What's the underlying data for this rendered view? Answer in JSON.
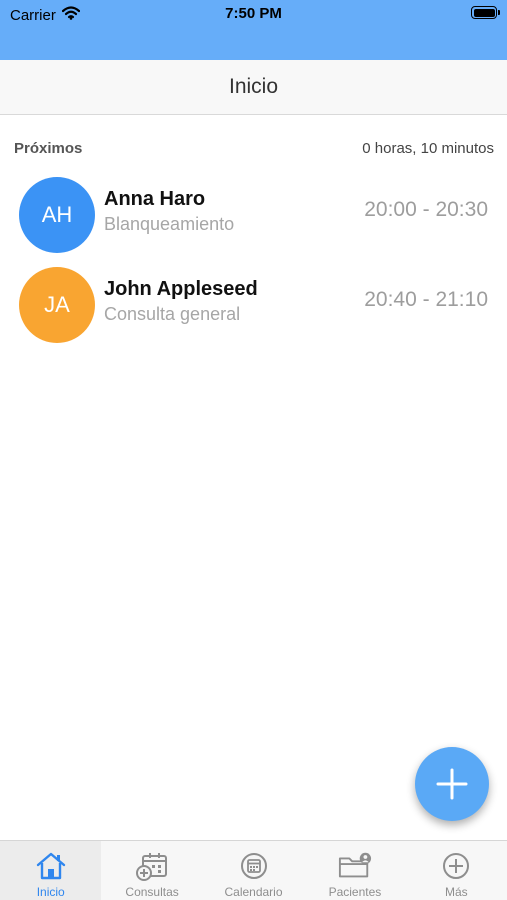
{
  "status_bar": {
    "carrier": "Carrier",
    "time": "7:50 PM"
  },
  "nav": {
    "title": "Inicio"
  },
  "section": {
    "title": "Próximos",
    "remaining": "0 horas, 10 minutos"
  },
  "appointments": [
    {
      "initials": "AH",
      "name": "Anna Haro",
      "treatment": "Blanqueamiento",
      "time": "20:00 - 20:30",
      "avatar_color": "#3b93f5"
    },
    {
      "initials": "JA",
      "name": "John Appleseed",
      "treatment": "Consulta general",
      "time": "20:40 - 21:10",
      "avatar_color": "#f9a531"
    }
  ],
  "tabs": [
    {
      "label": "Inicio",
      "icon": "home-icon",
      "active": true
    },
    {
      "label": "Consultas",
      "icon": "calendar-add-icon",
      "active": false
    },
    {
      "label": "Calendario",
      "icon": "calendar-icon",
      "active": false
    },
    {
      "label": "Pacientes",
      "icon": "patients-folder-icon",
      "active": false
    },
    {
      "label": "Más",
      "icon": "plus-circle-icon",
      "active": false
    }
  ],
  "colors": {
    "accent": "#2f86ee",
    "status_bar": "#66adf9",
    "fab": "#5aa9f6"
  }
}
